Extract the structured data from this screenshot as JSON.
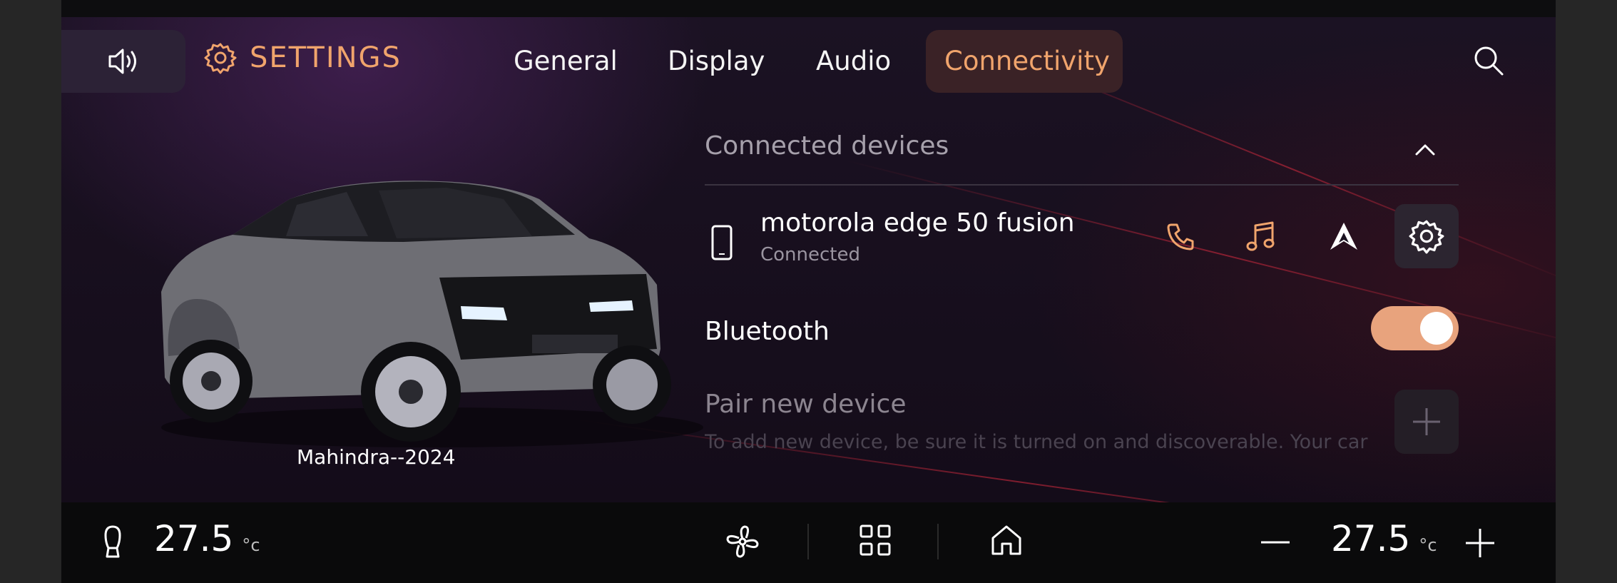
{
  "header": {
    "title": "SETTINGS",
    "tabs": [
      {
        "label": "General",
        "active": false
      },
      {
        "label": "Display",
        "active": false
      },
      {
        "label": "Audio",
        "active": false
      },
      {
        "label": "Connectivity",
        "active": true
      }
    ]
  },
  "car": {
    "label": "Mahindra--2024"
  },
  "connected_devices": {
    "title": "Connected devices",
    "device": {
      "name": "motorola edge 50 fusion",
      "status": "Connected"
    },
    "actions": [
      "phone-icon",
      "music-icon",
      "android-auto-icon",
      "gear-icon"
    ]
  },
  "bluetooth": {
    "label": "Bluetooth",
    "enabled": true
  },
  "pair": {
    "title": "Pair new device",
    "description": "To add new device, be sure it is turned on and discoverable. Your car"
  },
  "climate": {
    "left_temp": "27.5",
    "right_temp": "27.5",
    "unit": "°c"
  },
  "colors": {
    "accent": "#f0a46c",
    "toggle_on": "#e8a37d",
    "active_tab_bg": "#3a2226"
  }
}
